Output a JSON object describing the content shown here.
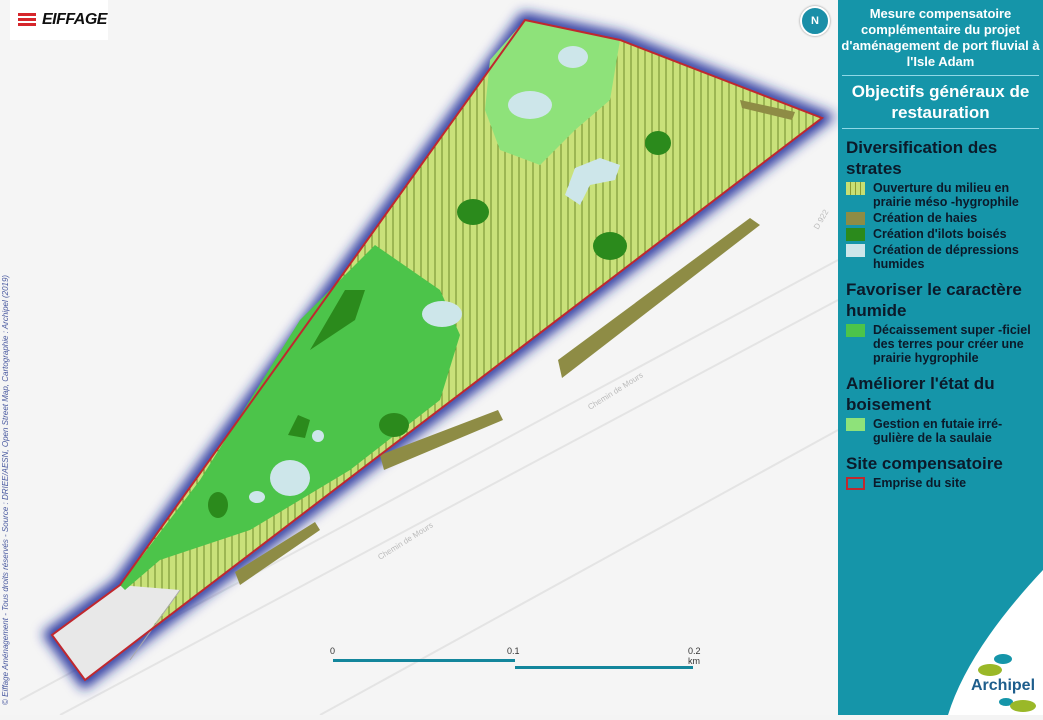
{
  "logo_text": "EIFFAGE",
  "credits": "© Eiffage Aménagement - Tous droits réservés - Source : DRIEE/AESN, Open Street Map, Cartographie : Archipel (2019)",
  "north_label": "N",
  "road_labels": [
    "D 922",
    "Chemin de Mours",
    "Chemin de Mours"
  ],
  "scale": {
    "labels": [
      "0",
      "0.1",
      "0.2 km"
    ]
  },
  "panel": {
    "title": "Mesure compensatoire complémentaire du projet d'aménagement de port fluvial à l'Isle Adam",
    "subtitle": "Objectifs généraux de restauration",
    "sections": [
      {
        "title": "Diversification des strates",
        "items": [
          {
            "label": "Ouverture du milieu en prairie méso -hygrophile",
            "color": "#c7df73"
          },
          {
            "label": "Création de haies",
            "color": "#8e8c45"
          },
          {
            "label": "Création d'ilots boisés",
            "color": "#2b8a1c"
          },
          {
            "label": "Création de dépressions humides",
            "color": "#cde6ea"
          }
        ]
      },
      {
        "title": "Favoriser le caractère humide",
        "items": [
          {
            "label": "Décaissement super -ficiel des terres pour créer une prairie hygrophile",
            "color": "#4cc44a"
          }
        ]
      },
      {
        "title": "Améliorer l'état du boisement",
        "items": [
          {
            "label": "Gestion en futaie irré- gulière de la saulaie",
            "color": "#8ee27a"
          }
        ]
      },
      {
        "title": "Site compensatoire",
        "items": [
          {
            "label": "Emprise du site",
            "color": "#c0282e"
          }
        ]
      }
    ],
    "logo_text": "Archipel"
  },
  "colors": {
    "panel": "#1595a9",
    "site_outline": "#c0282e",
    "glow": "#1a2a9a"
  }
}
